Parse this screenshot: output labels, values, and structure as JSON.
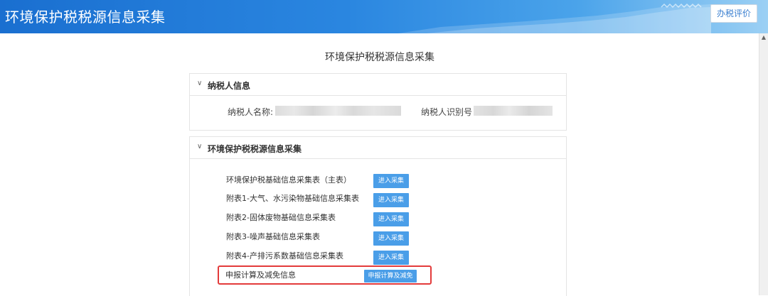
{
  "header": {
    "title": "环境保护税税源信息采集",
    "eval_button": "办税评价"
  },
  "page": {
    "title": "环境保护税税源信息采集"
  },
  "taxpayer_panel": {
    "heading": "纳税人信息",
    "name_label": "纳税人名称:",
    "id_label": "纳税人识别号"
  },
  "collection_panel": {
    "heading": "环境保护税税源信息采集",
    "rows": [
      {
        "label": "环境保护税基础信息采集表（主表）",
        "button": "进入采集"
      },
      {
        "label": "附表1-大气、水污染物基础信息采集表",
        "button": "进入采集"
      },
      {
        "label": "附表2-固体废物基础信息采集表",
        "button": "进入采集"
      },
      {
        "label": "附表3-噪声基础信息采集表",
        "button": "进入采集"
      },
      {
        "label": "附表4-产排污系数基础信息采集表",
        "button": "进入采集"
      }
    ],
    "calc": {
      "label": "申报计算及减免信息",
      "button": "申报计算及减免"
    }
  },
  "colors": {
    "header_blue": "#2a86e0",
    "button_blue": "#4a9ee8",
    "highlight_red": "#e33b3b"
  },
  "icons": {
    "collapse": "chevron-down-icon",
    "scroll_up": "arrow-up-icon"
  }
}
